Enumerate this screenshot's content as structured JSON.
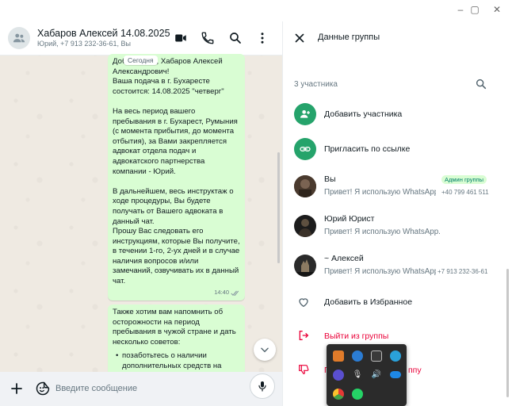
{
  "window": {
    "minimize": "–",
    "maximize": "▢",
    "close": "✕"
  },
  "chat": {
    "title": "Хабаров Алексей 14.08.2025",
    "subtitle": "Юрий, +7 913 232-36-61, Вы",
    "date_chip": "Сегодня",
    "message1": {
      "paragraphs": [
        "Доброго дня, Хабаров Алексей Александрович!\nВаша подача в г. Бухаресте состоится: 14.08.2025 \"четверг\"",
        "На весь период вашего пребывания в г. Бухарест, Румыния (с момента прибытия, до момента отбытия), за Вами закрепляется адвокат отдела подач и адвокатского партнерства компании - Юрий.",
        "В дальнейшем, весь инструктаж о ходе процедуры, Вы будете получать от Вашего адвоката в данный чат.\nПрошу Вас следовать его инструкциям, которые Вы получите, в течении 1-го, 2-ух дней и в случае наличия вопросов и/или замечаний, озвучивать их в данный чат."
      ],
      "time": "14:40"
    },
    "message2": {
      "text": "Также хотим вам напомнить об осторожности на период пребывания в чужой стране и дать несколько советов:",
      "bullet": "позаботьтесь о наличии дополнительных средств на"
    },
    "composer_placeholder": "Введите сообщение"
  },
  "panel": {
    "title": "Данные группы",
    "members_count": "3 участника",
    "add_member": "Добавить участника",
    "invite_link": "Пригласить по ссылке",
    "members": [
      {
        "name": "Вы",
        "status": "Привет! Я использую WhatsApp.",
        "phone": "+40 799 461 511",
        "badge": "Админ группы"
      },
      {
        "name": "Юрий Юрист",
        "status": "Привет! Я использую WhatsApp."
      },
      {
        "name": "~ Алексей",
        "status": "Привет! Я использую WhatsApp.",
        "phone": "+7 913 232-36-61"
      }
    ],
    "add_favorites": "Добавить в Избранное",
    "exit_group": "Выйти из группы",
    "report_group": "Пожаловаться на группу",
    "report_visible": "П",
    "report_tail": "ппу"
  },
  "colors": {
    "accent": "#25a36b",
    "danger": "#ea0038",
    "bubble": "#d9fdd3"
  }
}
